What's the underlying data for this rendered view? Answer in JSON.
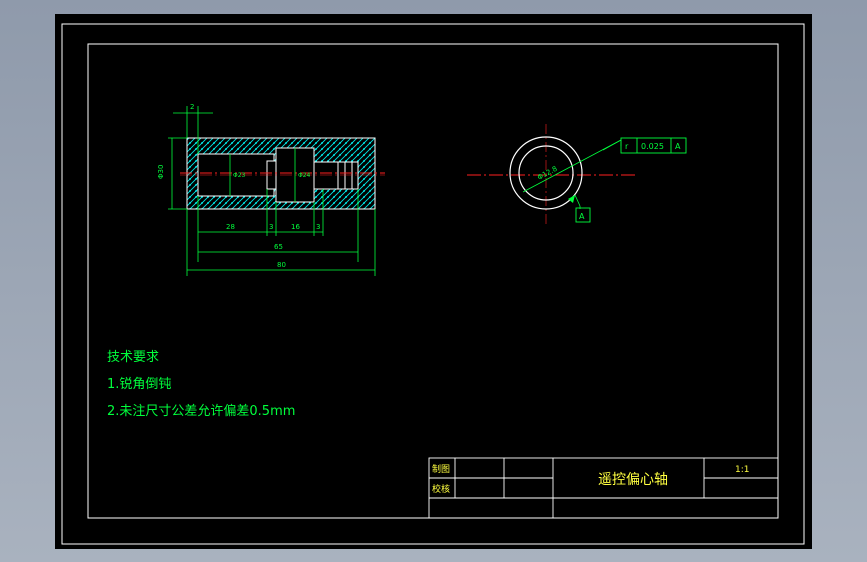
{
  "drawing": {
    "name": "遥控偏心轴",
    "scale": "1:1",
    "title_block": {
      "drawn_label": "制图",
      "checked_label": "校核"
    }
  },
  "dimensions": {
    "top_small": "2",
    "height": "Φ30",
    "inner_left": "Φ23",
    "inner_mid": "Φ24",
    "seg_left": "28",
    "gap_a": "3",
    "seg_mid": "16",
    "gap_b": "3",
    "overall_inner": "65",
    "overall": "80"
  },
  "side_view": {
    "diameter_label": "Φ12.8",
    "tolerance_symbol": "r",
    "tolerance_value": "0.025",
    "datum": "A",
    "datum_flag": "A"
  },
  "notes": {
    "heading": "技术要求",
    "item1": "1.锐角倒钝",
    "item2": "2.未注尺寸公差允许偏差0.5mm"
  },
  "colors": {
    "page_bg": "#9aa4b3",
    "sheet": "#000000",
    "frame": "#ffffff",
    "dimension": "#00ff3c",
    "hatch": "#00ffff",
    "centerline": "#ff2020",
    "yellow_text": "#ffff40"
  }
}
